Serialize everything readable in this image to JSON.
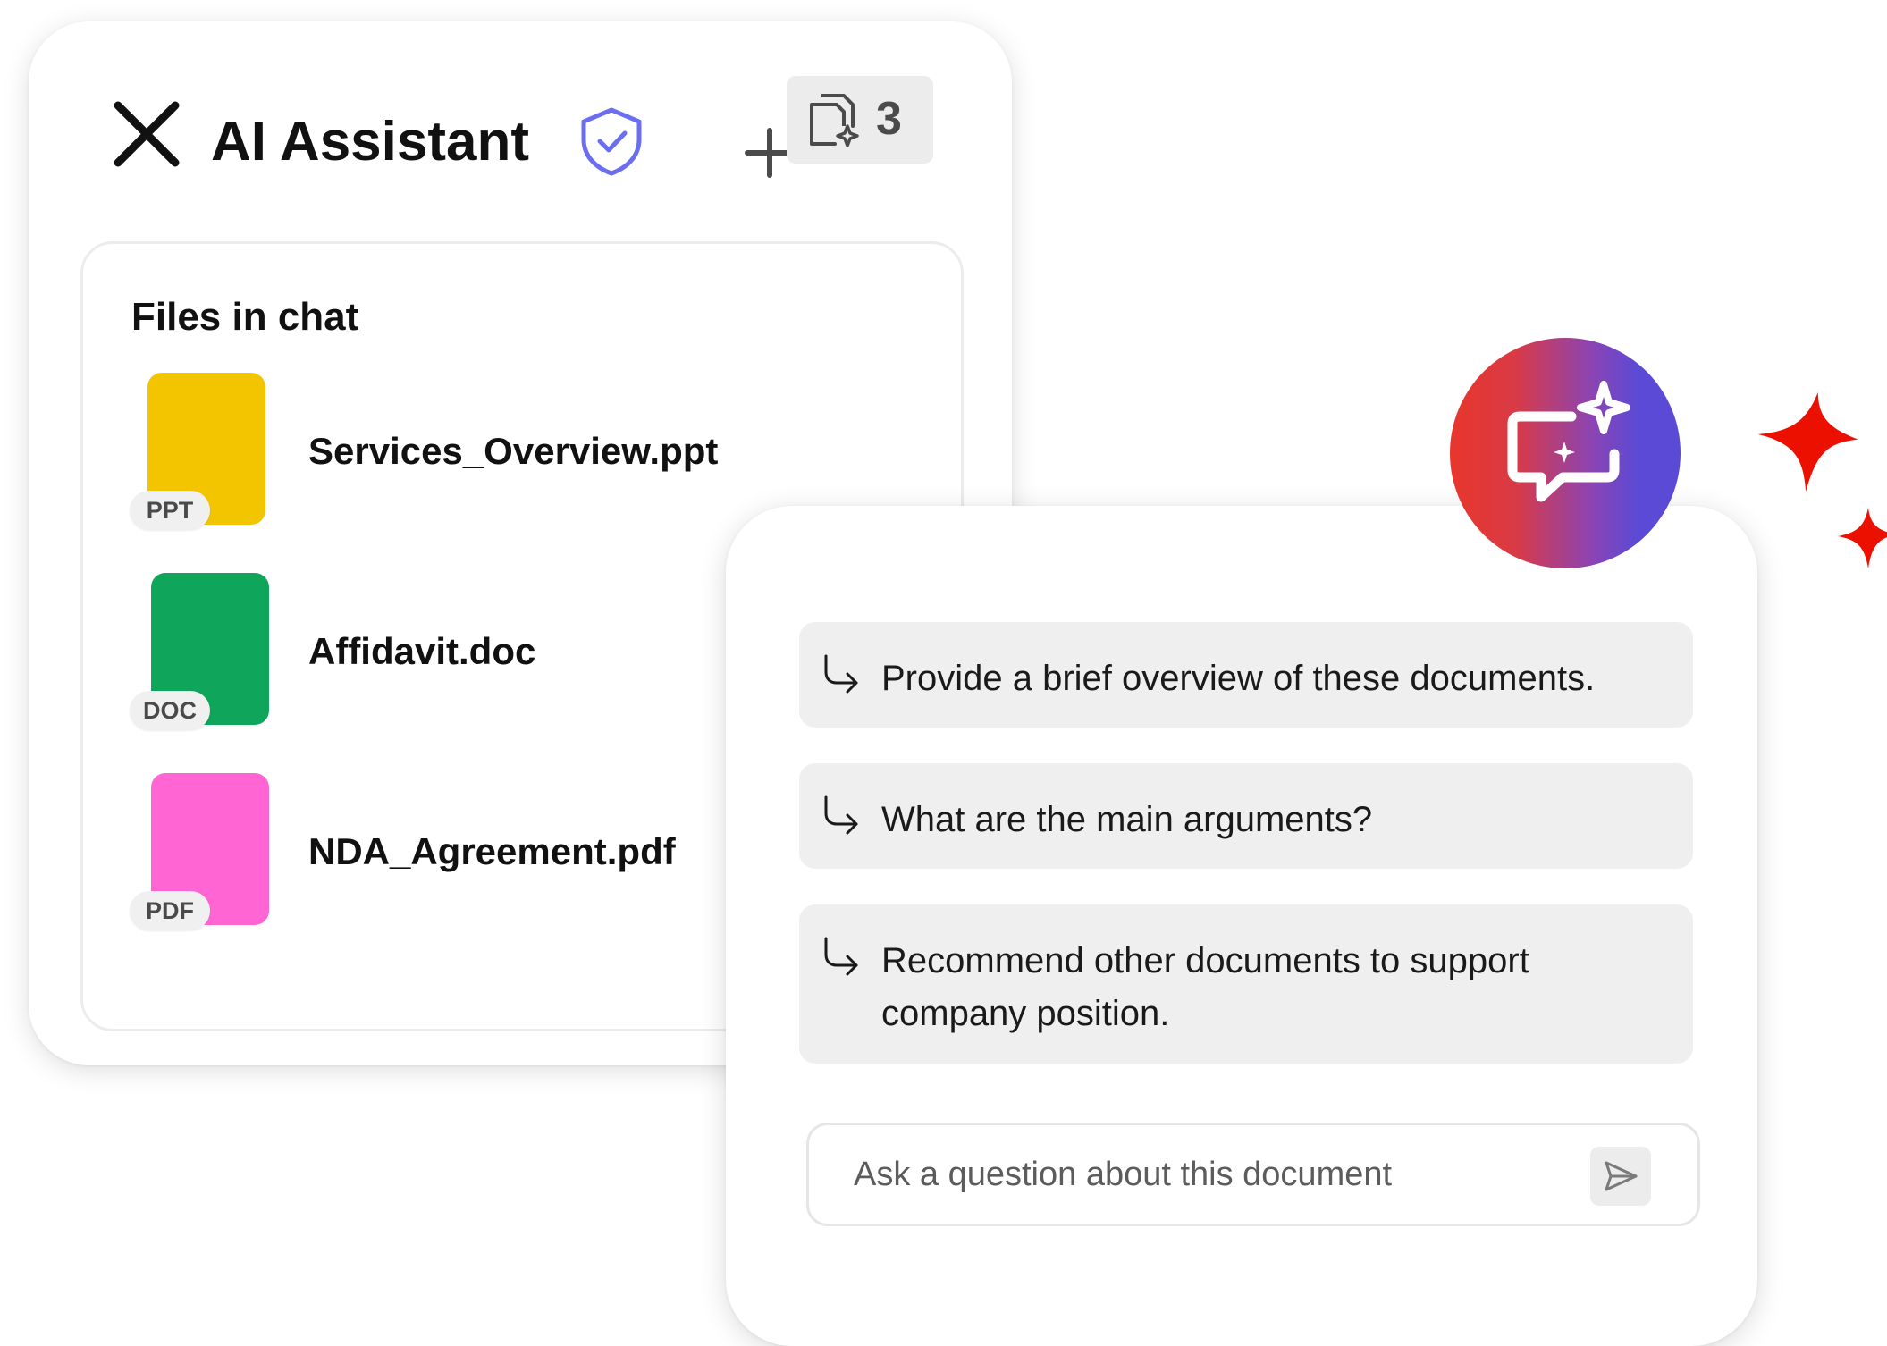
{
  "colors": {
    "ppt_thumbnail": "#F2C500",
    "doc_thumbnail": "#0FA55A",
    "pdf_thumbnail": "#FF66D4",
    "shield_accent": "#6B6FEF",
    "sparkle_red": "#EB1000",
    "badge_gradient_start": "#E8362C",
    "badge_gradient_end": "#5A4AD6"
  },
  "assistant": {
    "title": "AI Assistant",
    "close_icon": "close-icon",
    "shield_icon": "shield-check-icon",
    "add_icon": "plus-icon",
    "files_icon": "documents-sparkle-icon",
    "files_count": "3"
  },
  "files": {
    "heading": "Files in chat",
    "items": [
      {
        "name": "Services_Overview.ppt",
        "type": "PPT"
      },
      {
        "name": "Affidavit.doc",
        "type": "DOC"
      },
      {
        "name": "NDA_Agreement.pdf",
        "type": "PDF"
      }
    ]
  },
  "chat": {
    "badge_icon": "chat-sparkle-icon",
    "suggestions": [
      "Provide a brief overview of these documents.",
      "What are the main arguments?",
      "Recommend other documents to support company position."
    ],
    "input_placeholder": "Ask a question about this document",
    "send_icon": "send-icon"
  }
}
